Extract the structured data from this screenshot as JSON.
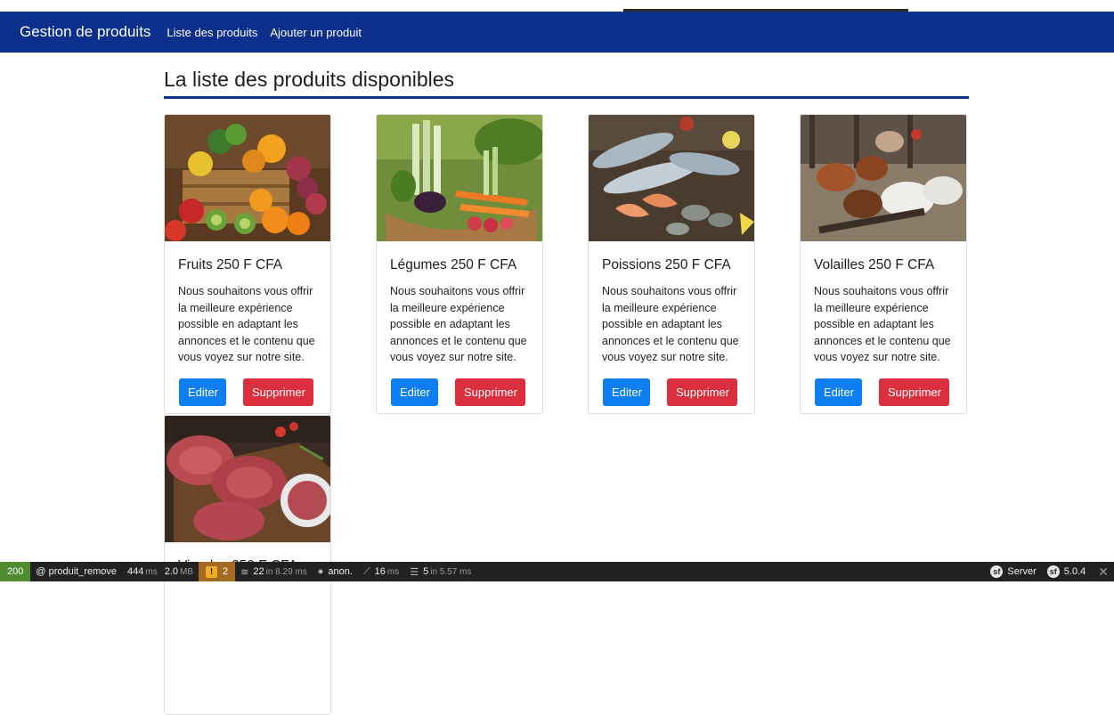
{
  "navbar": {
    "brand": "Gestion de produits",
    "links": [
      "Liste des produits",
      "Ajouter un produit"
    ]
  },
  "page_title": "La liste des produits disponibles",
  "cards": [
    {
      "title": "Fruits 250 F CFA",
      "text": "Nous souhaitons vous offrir la meilleure expérience possible en adaptant les annonces et le contenu que vous voyez sur notre site.",
      "edit_label": "Editer",
      "delete_label": "Supprimer",
      "image": "fruits-image"
    },
    {
      "title": "Légumes 250 F CFA",
      "text": "Nous souhaitons vous offrir la meilleure expérience possible en adaptant les annonces et le contenu que vous voyez sur notre site.",
      "edit_label": "Editer",
      "delete_label": "Supprimer",
      "image": "vegetables-image"
    },
    {
      "title": "Poissions 250 F CFA",
      "text": "Nous souhaitons vous offrir la meilleure expérience possible en adaptant les annonces et le contenu que vous voyez sur notre site.",
      "edit_label": "Editer",
      "delete_label": "Supprimer",
      "image": "fish-image"
    },
    {
      "title": "Volailles 250 F CFA",
      "text": "Nous souhaitons vous offrir la meilleure expérience possible en adaptant les annonces et le contenu que vous voyez sur notre site.",
      "edit_label": "Editer",
      "delete_label": "Supprimer",
      "image": "poultry-image"
    },
    {
      "title": "Viandes 250 F CFA",
      "image": "meat-image"
    }
  ],
  "toolbar": {
    "status": "200",
    "route": "@ produit_remove",
    "time_value": "444",
    "time_unit": "ms",
    "memory_value": "2.0",
    "memory_unit": "MB",
    "warnings": "2",
    "cache_value": "22",
    "cache_detail": "in 8.29 ms",
    "user": "anon.",
    "twig_value": "16",
    "twig_unit": "ms",
    "db_value": "5",
    "db_detail": "in 5.57 ms",
    "server_label": "Server",
    "version": "5.0.4"
  },
  "colors": {
    "navbar": "#0b2f8a",
    "edit_button": "#0d7ff2",
    "delete_button": "#dc2f3d",
    "toolbar": "#222222",
    "status_ok": "#4f8c2f",
    "warning": "#a46a1f"
  }
}
